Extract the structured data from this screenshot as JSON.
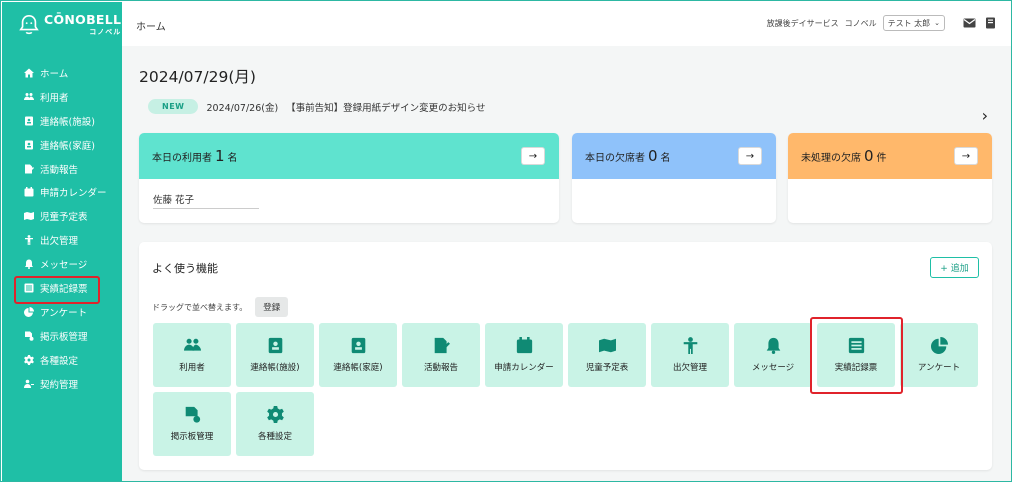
{
  "colors": {
    "sidebar": "#1fbfa6",
    "highlight": "#e0232b",
    "users_card": "#5fe3cf",
    "absent_card": "#8fc2fa",
    "unprocessed_card": "#ffb86b",
    "tile": "#c9f3e6"
  },
  "logo": {
    "title": "CŌNOBELL",
    "sub": "コノベル"
  },
  "sidebar": {
    "items": [
      {
        "label": "ホーム",
        "icon": "home-icon"
      },
      {
        "label": "利用者",
        "icon": "users-icon"
      },
      {
        "label": "連絡帳(施設)",
        "icon": "contact-book-icon"
      },
      {
        "label": "連絡帳(家庭)",
        "icon": "contact-book-icon"
      },
      {
        "label": "活動報告",
        "icon": "report-icon"
      },
      {
        "label": "申請カレンダー",
        "icon": "calendar-icon"
      },
      {
        "label": "児童予定表",
        "icon": "map-icon"
      },
      {
        "label": "出欠管理",
        "icon": "person-icon"
      },
      {
        "label": "メッセージ",
        "icon": "bell-icon"
      },
      {
        "label": "実績記録票",
        "icon": "list-icon"
      },
      {
        "label": "アンケート",
        "icon": "pie-icon"
      },
      {
        "label": "掲示板管理",
        "icon": "board-icon"
      },
      {
        "label": "各種設定",
        "icon": "gear-icon"
      },
      {
        "label": "契約管理",
        "icon": "contract-icon"
      }
    ]
  },
  "topbar": {
    "breadcrumb": "ホーム",
    "service": "放課後デイサービス",
    "org": "コノベル",
    "user": "テスト 太郎"
  },
  "date": "2024/07/29(月)",
  "news": {
    "badge": "NEW",
    "date": "2024/07/26(金)",
    "text": "【事前告知】登録用紙デザイン変更のお知らせ",
    "arrow": "›"
  },
  "cards": {
    "users": {
      "prefix": "本日の利用者",
      "count": "1",
      "suffix": "名",
      "button": "→",
      "people": [
        "佐藤 花子"
      ]
    },
    "absent": {
      "prefix": "本日の欠席者",
      "count": "0",
      "suffix": "名",
      "button": "→"
    },
    "unprocessed": {
      "prefix": "未処理の欠席",
      "count": "0",
      "suffix": "件",
      "button": "→"
    }
  },
  "favorites": {
    "title": "よく使う機能",
    "add_label": "+ 追加",
    "hint": "ドラッグで並べ替えます。",
    "register": "登録",
    "tiles": [
      {
        "label": "利用者",
        "icon": "users-icon"
      },
      {
        "label": "連絡帳(施設)",
        "icon": "contact-book-icon"
      },
      {
        "label": "連絡帳(家庭)",
        "icon": "contact-book-icon"
      },
      {
        "label": "活動報告",
        "icon": "report-icon"
      },
      {
        "label": "申請カレンダー",
        "icon": "calendar-icon"
      },
      {
        "label": "児童予定表",
        "icon": "map-icon"
      },
      {
        "label": "出欠管理",
        "icon": "person-icon"
      },
      {
        "label": "メッセージ",
        "icon": "bell-icon"
      },
      {
        "label": "実績記録票",
        "icon": "list-icon"
      },
      {
        "label": "アンケート",
        "icon": "pie-icon"
      },
      {
        "label": "掲示板管理",
        "icon": "board-icon"
      },
      {
        "label": "各種設定",
        "icon": "gear-icon"
      }
    ]
  }
}
